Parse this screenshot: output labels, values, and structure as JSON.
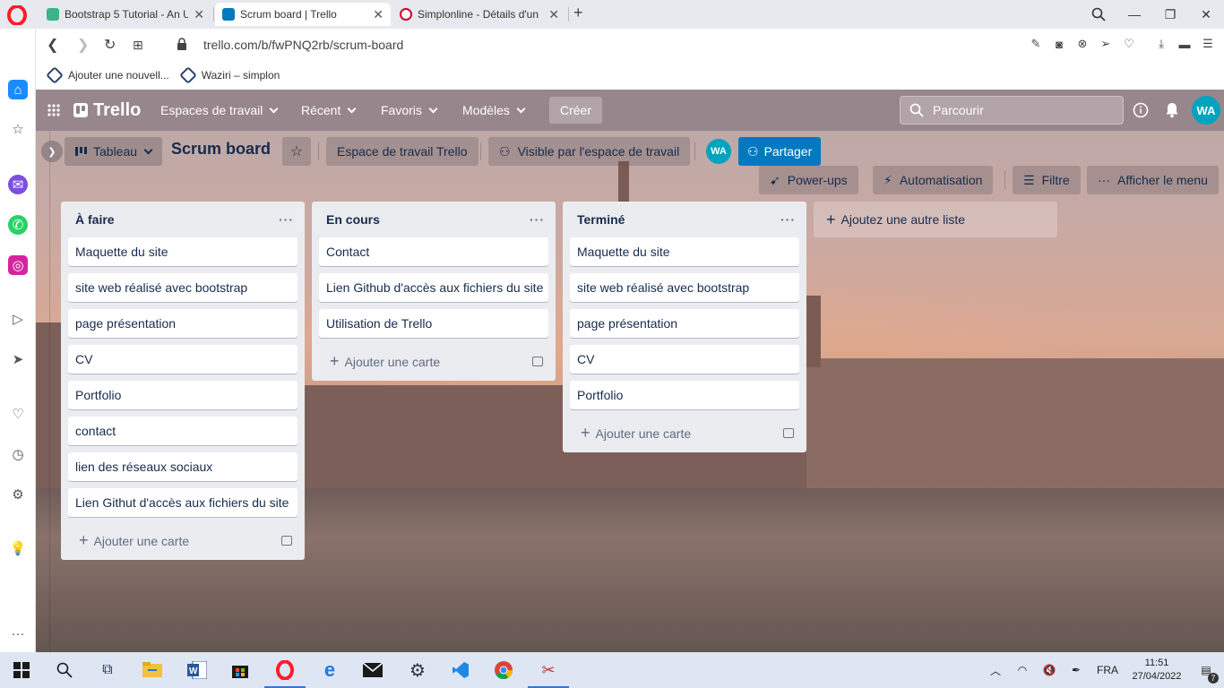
{
  "browser": {
    "tabs": [
      {
        "title": "Bootstrap 5 Tutorial - An U",
        "favicon_color": "#3cb38a",
        "active": false
      },
      {
        "title": "Scrum board | Trello",
        "favicon_color": "#0079bf",
        "active": true
      },
      {
        "title": "Simplonline - Détails d'un ",
        "favicon_color": "#ce0033",
        "active": false
      }
    ],
    "url": "trello.com/b/fwPNQ2rb/scrum-board",
    "bookmarks": [
      "Ajouter une nouvell...",
      "Waziri – simplon"
    ]
  },
  "trello": {
    "logo_text": "Trello",
    "nav": {
      "workspaces": "Espaces de travail",
      "recent": "Récent",
      "favorites": "Favoris",
      "templates": "Modèles",
      "create": "Créer"
    },
    "search_placeholder": "Parcourir",
    "user_initials": "WA",
    "board": {
      "view_label": "Tableau",
      "title": "Scrum board",
      "workspace": "Espace de travail Trello",
      "visibility": "Visible par l'espace de travail",
      "share": "Partager",
      "powerups": "Power-ups",
      "automation": "Automatisation",
      "filter": "Filtre",
      "show_menu": "Afficher le menu",
      "add_list": "Ajoutez une autre liste",
      "add_card": "Ajouter une carte"
    },
    "lists": [
      {
        "title": "À faire",
        "cards": [
          "Maquette du site",
          "site web réalisé avec bootstrap",
          "page présentation",
          "CV",
          "Portfolio",
          "contact",
          "lien des réseaux sociaux",
          "Lien Githut d'accès aux fichiers du site"
        ]
      },
      {
        "title": "En cours",
        "cards": [
          "Contact",
          "Lien Github d'accès aux fichiers du site",
          "Utilisation de Trello"
        ]
      },
      {
        "title": "Terminé",
        "cards": [
          "Maquette du site",
          "site web réalisé avec bootstrap",
          "page présentation",
          "CV",
          "Portfolio"
        ]
      }
    ]
  },
  "taskbar": {
    "language": "FRA",
    "time": "11:51",
    "date": "27/04/2022",
    "notification_count": "7"
  },
  "colors": {
    "trello_blue": "#0079bf",
    "list_bg": "#ebecf0",
    "opera_red": "#ff1b2d"
  }
}
